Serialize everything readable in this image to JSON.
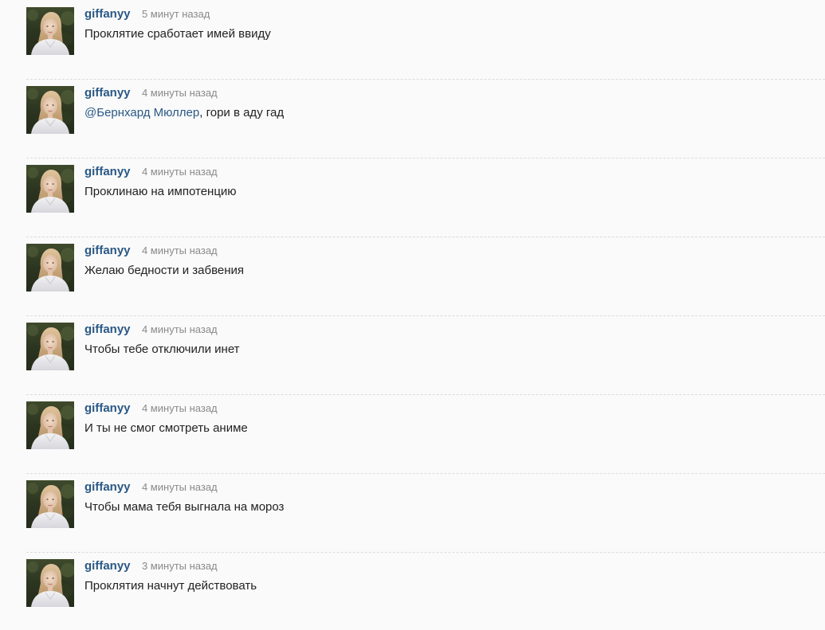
{
  "colors": {
    "username": "#2a5885",
    "timestamp": "#8a8a8a",
    "text": "#222222",
    "divider": "#dcdcdc",
    "background": "#fafafa"
  },
  "comments": [
    {
      "username": "giffanyy",
      "time": "5 минут назад",
      "text": "Проклятие сработает имей ввиду",
      "avatar": "user-avatar-photo"
    },
    {
      "username": "giffanyy",
      "time": "4 минуты назад",
      "mention": "@Бернхард Мюллер",
      "text": ", гори в аду гад",
      "avatar": "user-avatar-photo"
    },
    {
      "username": "giffanyy",
      "time": "4 минуты назад",
      "text": "Проклинаю на импотенцию",
      "avatar": "user-avatar-photo"
    },
    {
      "username": "giffanyy",
      "time": "4 минуты назад",
      "text": "Желаю бедности и забвения",
      "avatar": "user-avatar-photo"
    },
    {
      "username": "giffanyy",
      "time": "4 минуты назад",
      "text": "Чтобы тебе отключили инет",
      "avatar": "user-avatar-photo"
    },
    {
      "username": "giffanyy",
      "time": "4 минуты назад",
      "text": "И ты не смог смотреть аниме",
      "avatar": "user-avatar-photo"
    },
    {
      "username": "giffanyy",
      "time": "4 минуты назад",
      "text": "Чтобы мама тебя выгнала на мороз",
      "avatar": "user-avatar-photo"
    },
    {
      "username": "giffanyy",
      "time": "3 минуты назад",
      "text": "Проклятия начнут действовать",
      "avatar": "user-avatar-photo"
    }
  ]
}
